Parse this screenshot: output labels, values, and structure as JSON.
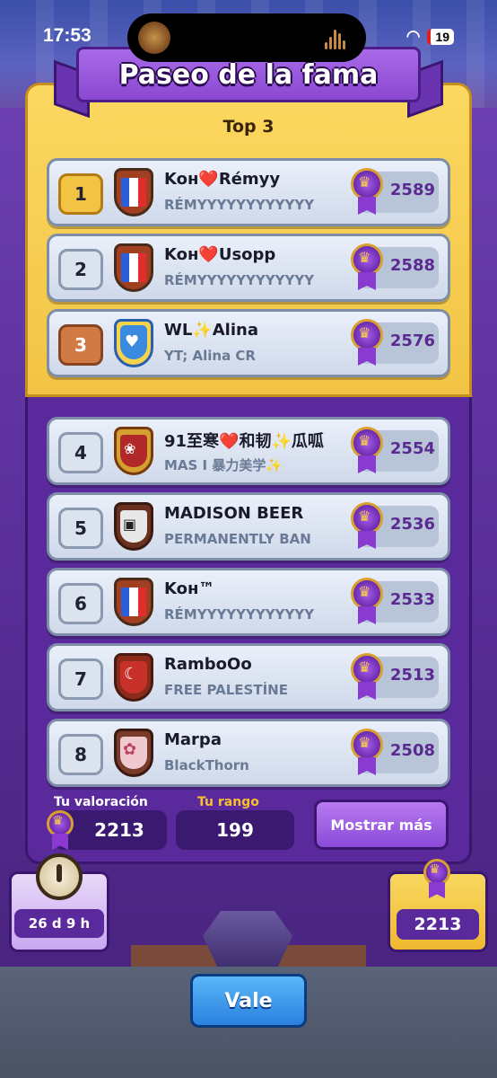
{
  "status_bar": {
    "time": "17:53",
    "battery": "19"
  },
  "header": {
    "title": "Paseo de la fama"
  },
  "top3": {
    "title": "Top 3"
  },
  "players": [
    {
      "rank": "1",
      "name": "Koн❤️Rémyy",
      "clan": "RÉMYYYYYYYYYYYY",
      "trophies": "2589",
      "badge": "fr"
    },
    {
      "rank": "2",
      "name": "Koн❤️Usopp",
      "clan": "RÉMYYYYYYYYYYYY",
      "trophies": "2588",
      "badge": "fr"
    },
    {
      "rank": "3",
      "name": "WL✨Alina",
      "clan": "YT; Alina CR",
      "trophies": "2576",
      "badge": "blue"
    },
    {
      "rank": "4",
      "name": "91至寒❤️和韧✨瓜呱",
      "clan": "MAS I 暴力美学✨",
      "trophies": "2554",
      "badge": "lotus"
    },
    {
      "rank": "5",
      "name": "MADISON BEER",
      "clan": "PERMANENTLY BAN",
      "trophies": "2536",
      "badge": "dark"
    },
    {
      "rank": "6",
      "name": "Koн™",
      "clan": "RÉMYYYYYYYYYYYY",
      "trophies": "2533",
      "badge": "fr"
    },
    {
      "rank": "7",
      "name": "RamboOo",
      "clan": "FREE PALESTİNE",
      "trophies": "2513",
      "badge": "red"
    },
    {
      "rank": "8",
      "name": "Marpa",
      "clan": "BlackThorn",
      "trophies": "2508",
      "badge": "pink"
    }
  ],
  "my_stats": {
    "rating_label": "Tu valoración",
    "rating_value": "2213",
    "rank_label": "Tu rango",
    "rank_value": "199",
    "more_button": "Mostrar más"
  },
  "season": {
    "timer": "26 d 9 h",
    "trophies": "2213"
  },
  "footer": {
    "ok_button": "Vale"
  },
  "colors": {
    "accent_purple": "#5a2a9c",
    "gold": "#f2c445",
    "button_blue": "#2a80e0"
  }
}
